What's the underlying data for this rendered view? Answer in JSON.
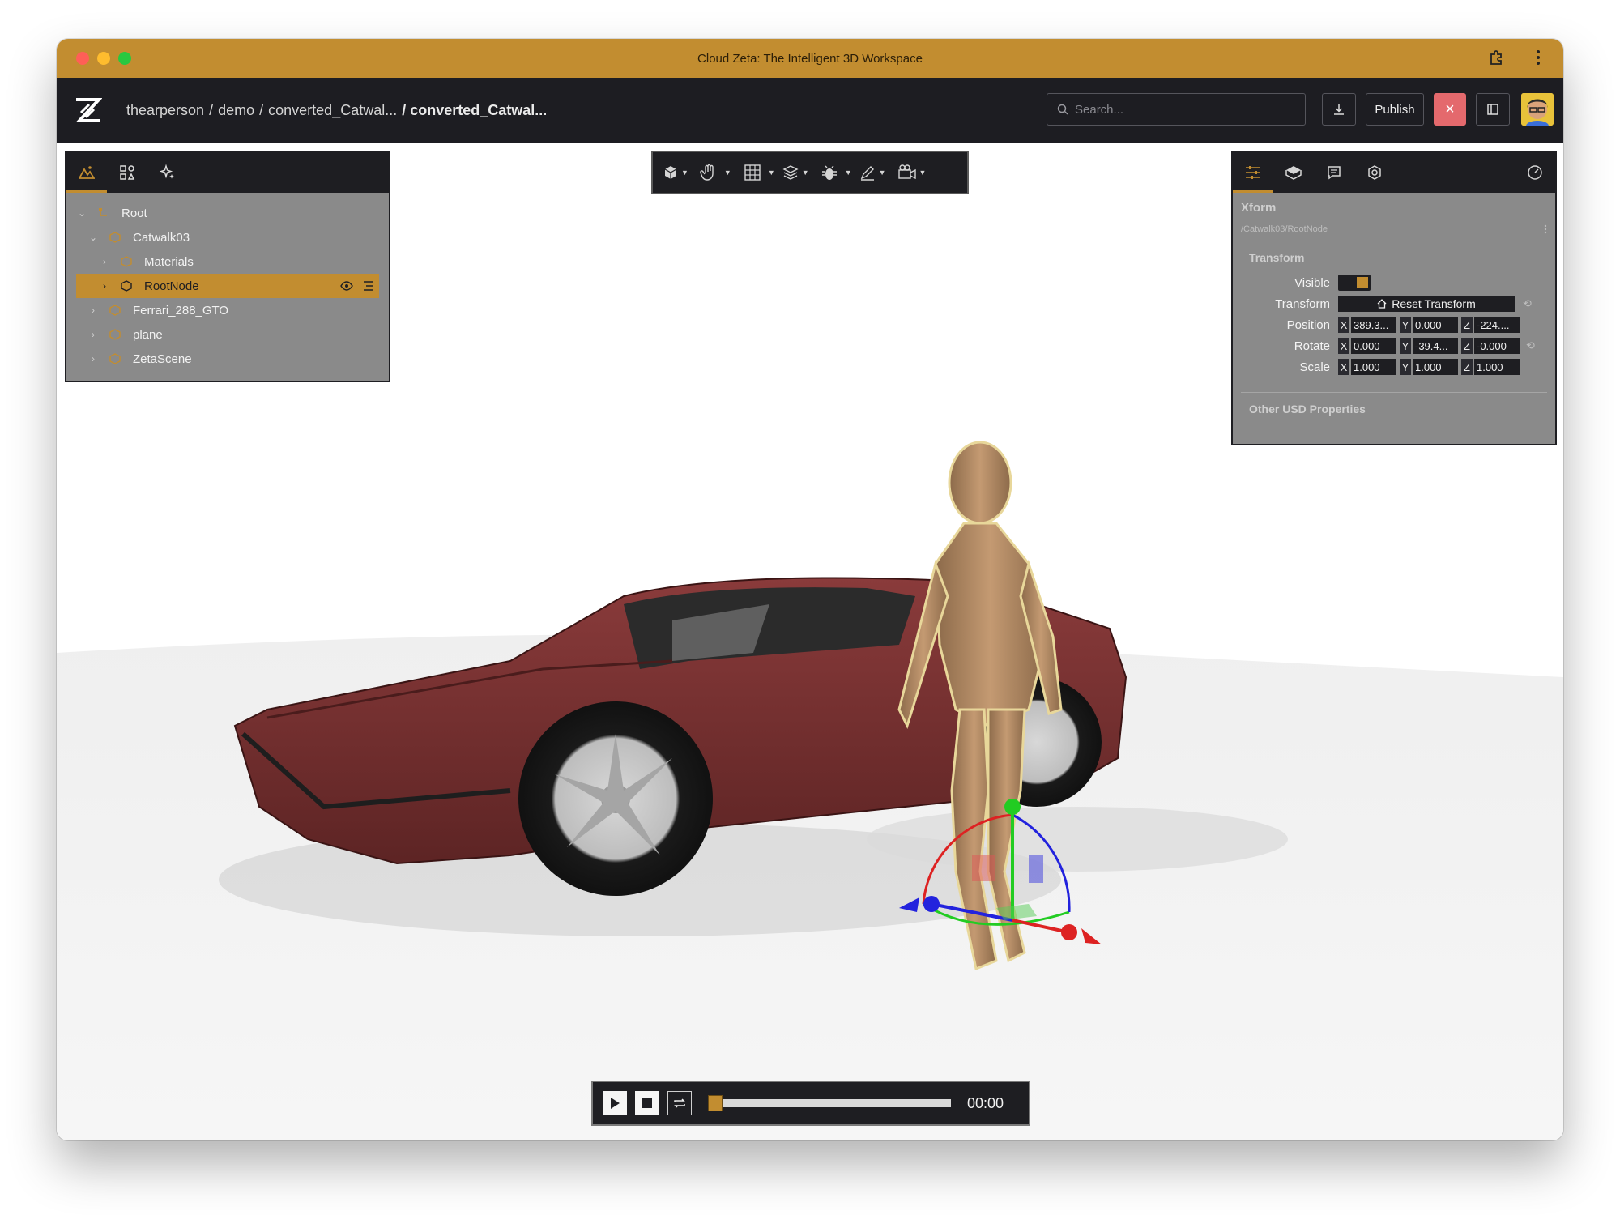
{
  "window": {
    "title": "Cloud Zeta: The Intelligent 3D Workspace"
  },
  "appbar": {
    "breadcrumb": [
      "thearperson",
      "/",
      "demo",
      "/",
      "converted_Catwal...",
      "/ converted_Catwal..."
    ],
    "search_placeholder": "Search...",
    "publish_label": "Publish",
    "close_label": "×"
  },
  "scene_panel": {
    "tabs": [
      "scene-tree",
      "asset-library",
      "ai-assist"
    ],
    "tree": [
      {
        "label": "Root",
        "depth": 0,
        "expanded": true,
        "selected": false
      },
      {
        "label": "Catwalk03",
        "depth": 1,
        "expanded": true,
        "selected": false
      },
      {
        "label": "Materials",
        "depth": 2,
        "expanded": false,
        "selected": false
      },
      {
        "label": "RootNode",
        "depth": 2,
        "expanded": false,
        "selected": true
      },
      {
        "label": "Ferrari_288_GTO",
        "depth": 1,
        "expanded": false,
        "selected": false
      },
      {
        "label": "plane",
        "depth": 1,
        "expanded": false,
        "selected": false
      },
      {
        "label": "ZetaScene",
        "depth": 1,
        "expanded": false,
        "selected": false
      }
    ]
  },
  "toolbar": {
    "tools": [
      "view-cube",
      "hand-tool",
      "grid",
      "layers",
      "debug",
      "draw",
      "camera"
    ]
  },
  "props_panel": {
    "type_title": "Xform",
    "path": "/Catwalk03/RootNode",
    "section": "Transform",
    "visible_label": "Visible",
    "transform_label": "Transform",
    "reset_label": "Reset Transform",
    "position": {
      "label": "Position",
      "x": "389.3...",
      "y": "0.000",
      "z": "-224...."
    },
    "rotate": {
      "label": "Rotate",
      "x": "0.000",
      "y": "-39.4...",
      "z": "-0.000"
    },
    "scale": {
      "label": "Scale",
      "x": "1.000",
      "y": "1.000",
      "z": "1.000"
    },
    "other_section": "Other USD Properties"
  },
  "player": {
    "time": "00:00",
    "progress": 0
  },
  "colors": {
    "accent": "#c28d30",
    "dark": "#1e1e22",
    "panel": "#8a8a8a",
    "close": "#e4696d"
  }
}
